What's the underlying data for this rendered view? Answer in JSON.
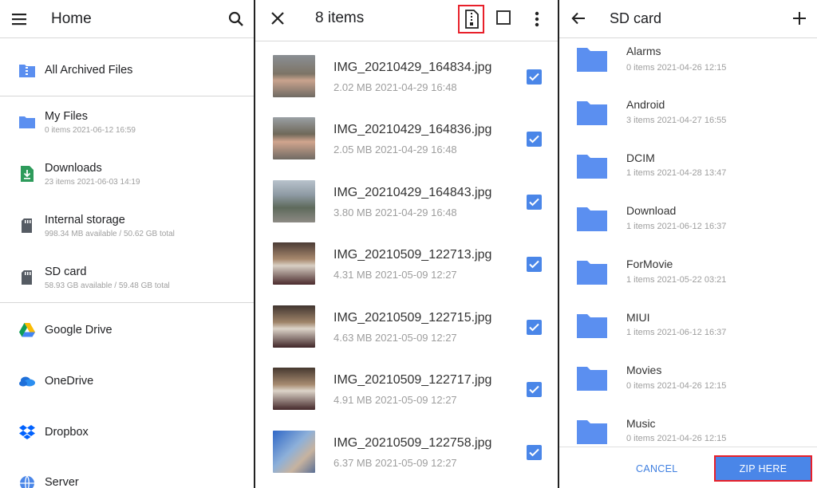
{
  "left_panel": {
    "title": "Home",
    "items": [
      {
        "title": "All Archived Files",
        "subtitle": "",
        "icon": "archive-folder-icon"
      },
      {
        "title": "My Files",
        "subtitle": "0 items 2021-06-12 16:59",
        "icon": "folder-icon"
      },
      {
        "title": "Downloads",
        "subtitle": "23 items 2021-06-03 14:19",
        "icon": "download-icon"
      },
      {
        "title": "Internal storage",
        "subtitle": "998.34 MB available / 50.62 GB total",
        "icon": "storage-icon"
      },
      {
        "title": "SD card",
        "subtitle": "58.93 GB available / 59.48 GB total",
        "icon": "sd-card-icon"
      },
      {
        "title": "Google Drive",
        "subtitle": "",
        "icon": "google-drive-icon"
      },
      {
        "title": "OneDrive",
        "subtitle": "",
        "icon": "onedrive-icon"
      },
      {
        "title": "Dropbox",
        "subtitle": "",
        "icon": "dropbox-icon"
      },
      {
        "title": "Server",
        "subtitle": "",
        "icon": "server-icon"
      }
    ]
  },
  "middle_panel": {
    "title": "8 items",
    "files": [
      {
        "name": "IMG_20210429_164834.jpg",
        "meta": "2.02 MB 2021-04-29 16:48",
        "checked": true
      },
      {
        "name": "IMG_20210429_164836.jpg",
        "meta": "2.05 MB 2021-04-29 16:48",
        "checked": true
      },
      {
        "name": "IMG_20210429_164843.jpg",
        "meta": "3.80 MB 2021-04-29 16:48",
        "checked": true
      },
      {
        "name": "IMG_20210509_122713.jpg",
        "meta": "4.31 MB 2021-05-09 12:27",
        "checked": true
      },
      {
        "name": "IMG_20210509_122715.jpg",
        "meta": "4.63 MB 2021-05-09 12:27",
        "checked": true
      },
      {
        "name": "IMG_20210509_122717.jpg",
        "meta": "4.91 MB 2021-05-09 12:27",
        "checked": true
      },
      {
        "name": "IMG_20210509_122758.jpg",
        "meta": "6.37 MB 2021-05-09 12:27",
        "checked": true
      }
    ]
  },
  "right_panel": {
    "title": "SD card",
    "folders": [
      {
        "name": "Alarms",
        "meta": "0 items 2021-04-26 12:15"
      },
      {
        "name": "Android",
        "meta": "3 items 2021-04-27 16:55"
      },
      {
        "name": "DCIM",
        "meta": "1 items 2021-04-28 13:47"
      },
      {
        "name": "Download",
        "meta": "1 items 2021-06-12 16:37"
      },
      {
        "name": "ForMovie",
        "meta": "1 items 2021-05-22 03:21"
      },
      {
        "name": "MIUI",
        "meta": "1 items 2021-06-12 16:37"
      },
      {
        "name": "Movies",
        "meta": "0 items 2021-04-26 12:15"
      },
      {
        "name": "Music",
        "meta": "0 items 2021-04-26 12:15"
      }
    ],
    "cancel_label": "CANCEL",
    "zip_label": "ZIP HERE"
  },
  "colors": {
    "accent": "#4a86e8",
    "highlight": "#e8202a",
    "folder": "#5b8ff0"
  }
}
